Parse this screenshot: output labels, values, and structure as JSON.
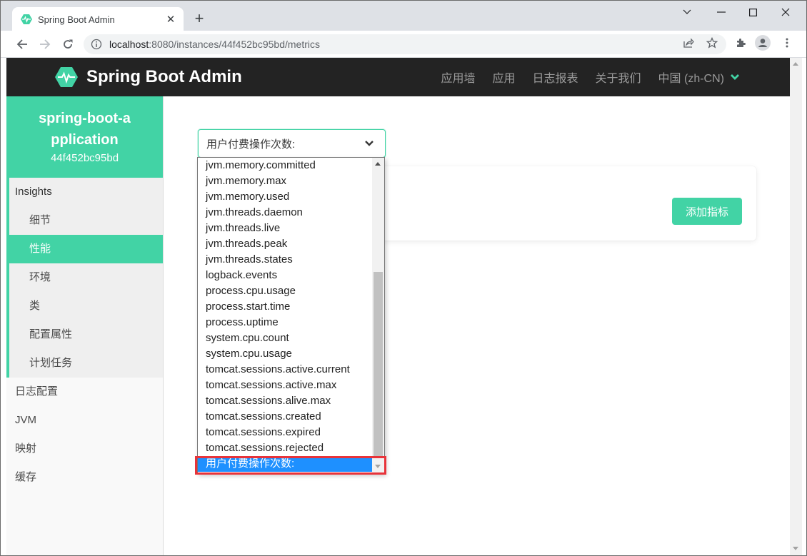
{
  "browser": {
    "tab_title": "Spring Boot Admin",
    "url_host": "localhost",
    "url_rest": ":8080/instances/44f452bc95bd/metrics",
    "icons": [
      "back-icon",
      "forward-icon",
      "reload-icon",
      "info-icon",
      "share-icon",
      "star-icon",
      "extensions-icon",
      "profile-icon",
      "menu-icon"
    ]
  },
  "navbar": {
    "brand": "Spring Boot Admin",
    "links": [
      "应用墙",
      "应用",
      "日志报表",
      "关于我们",
      "中国 (zh-CN)"
    ],
    "accent": "#42d3a5"
  },
  "sidebar": {
    "app_name": "spring-boot-application",
    "instance_id": "44f452bc95bd",
    "group_title": "Insights",
    "group_items": [
      "细节",
      "性能",
      "环境",
      "类",
      "配置属性",
      "计划任务"
    ],
    "active_item": "性能",
    "links": [
      "日志配置",
      "JVM",
      "映射",
      "缓存"
    ]
  },
  "main": {
    "select_value": "用户付费操作次数:",
    "add_button": "添加指标",
    "options": [
      "jvm.memory.committed",
      "jvm.memory.max",
      "jvm.memory.used",
      "jvm.threads.daemon",
      "jvm.threads.live",
      "jvm.threads.peak",
      "jvm.threads.states",
      "logback.events",
      "process.cpu.usage",
      "process.start.time",
      "process.uptime",
      "system.cpu.count",
      "system.cpu.usage",
      "tomcat.sessions.active.current",
      "tomcat.sessions.active.max",
      "tomcat.sessions.alive.max",
      "tomcat.sessions.created",
      "tomcat.sessions.expired",
      "tomcat.sessions.rejected",
      "用户付费操作次数:"
    ],
    "selected_option": "用户付费操作次数:",
    "highlight_color": "#e8333a",
    "selection_color": "#1e90ff"
  }
}
